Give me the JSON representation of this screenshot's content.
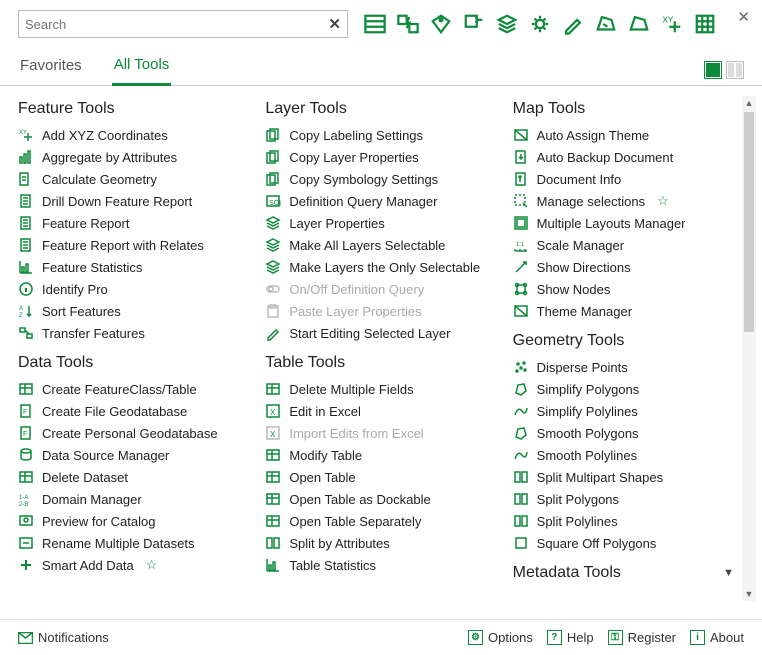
{
  "search": {
    "placeholder": "Search"
  },
  "tabs": {
    "favorites": "Favorites",
    "all_tools": "All Tools"
  },
  "toolbar_icons": [
    "panel",
    "bolt",
    "tag",
    "ins",
    "layers",
    "gear",
    "edit",
    "poly1",
    "poly2",
    "xy",
    "grid"
  ],
  "columns": [
    {
      "categories": [
        {
          "title": "Feature Tools",
          "tools": [
            {
              "label": "Add XYZ Coordinates",
              "icon": "xy"
            },
            {
              "label": "Aggregate by Attributes",
              "icon": "bars"
            },
            {
              "label": "Calculate Geometry",
              "icon": "calc"
            },
            {
              "label": "Drill Down Feature Report",
              "icon": "report"
            },
            {
              "label": "Feature Report",
              "icon": "report"
            },
            {
              "label": "Feature Report with Relates",
              "icon": "report"
            },
            {
              "label": "Feature Statistics",
              "icon": "stats"
            },
            {
              "label": "Identify Pro",
              "icon": "info"
            },
            {
              "label": "Sort Features",
              "icon": "sort"
            },
            {
              "label": "Transfer Features",
              "icon": "transfer"
            }
          ]
        },
        {
          "title": "Data Tools",
          "tools": [
            {
              "label": "Create FeatureClass/Table",
              "icon": "table"
            },
            {
              "label": "Create File Geodatabase",
              "icon": "file"
            },
            {
              "label": "Create Personal Geodatabase",
              "icon": "file"
            },
            {
              "label": "Data Source Manager",
              "icon": "db"
            },
            {
              "label": "Delete Dataset",
              "icon": "table"
            },
            {
              "label": "Domain Manager",
              "icon": "domain"
            },
            {
              "label": "Preview for Catalog",
              "icon": "preview"
            },
            {
              "label": "Rename Multiple Datasets",
              "icon": "rename"
            },
            {
              "label": "Smart Add Data",
              "icon": "add",
              "starred": true
            }
          ]
        }
      ]
    },
    {
      "categories": [
        {
          "title": "Layer Tools",
          "tools": [
            {
              "label": "Copy Labeling Settings",
              "icon": "copy"
            },
            {
              "label": "Copy Layer Properties",
              "icon": "copy"
            },
            {
              "label": "Copy Symbology Settings",
              "icon": "copy"
            },
            {
              "label": "Definition Query Manager",
              "icon": "query"
            },
            {
              "label": "Layer Properties",
              "icon": "layers"
            },
            {
              "label": "Make All Layers Selectable",
              "icon": "layers"
            },
            {
              "label": "Make Layers the Only Selectable",
              "icon": "layers"
            },
            {
              "label": "On/Off Definition Query",
              "icon": "toggle",
              "disabled": true
            },
            {
              "label": "Paste Layer Properties",
              "icon": "paste",
              "disabled": true
            },
            {
              "label": "Start Editing Selected Layer",
              "icon": "edit"
            }
          ]
        },
        {
          "title": "Table Tools",
          "tools": [
            {
              "label": "Delete Multiple Fields",
              "icon": "table"
            },
            {
              "label": "Edit in Excel",
              "icon": "excel"
            },
            {
              "label": "Import Edits from Excel",
              "icon": "excel",
              "disabled": true
            },
            {
              "label": "Modify Table",
              "icon": "table"
            },
            {
              "label": "Open Table",
              "icon": "table"
            },
            {
              "label": "Open Table as Dockable",
              "icon": "table"
            },
            {
              "label": "Open Table Separately",
              "icon": "table"
            },
            {
              "label": "Split by Attributes",
              "icon": "split"
            },
            {
              "label": "Table Statistics",
              "icon": "stats"
            }
          ]
        }
      ]
    },
    {
      "categories": [
        {
          "title": "Map Tools",
          "tools": [
            {
              "label": "Auto Assign Theme",
              "icon": "theme"
            },
            {
              "label": "Auto Backup Document",
              "icon": "backup"
            },
            {
              "label": "Document Info",
              "icon": "info2"
            },
            {
              "label": "Manage selections",
              "icon": "select",
              "starred": true
            },
            {
              "label": "Multiple Layouts Manager",
              "icon": "layout"
            },
            {
              "label": "Scale Manager",
              "icon": "scale"
            },
            {
              "label": "Show Directions",
              "icon": "dir"
            },
            {
              "label": "Show Nodes",
              "icon": "nodes"
            },
            {
              "label": "Theme Manager",
              "icon": "theme"
            }
          ]
        },
        {
          "title": "Geometry Tools",
          "tools": [
            {
              "label": "Disperse Points",
              "icon": "points"
            },
            {
              "label": "Simplify Polygons",
              "icon": "poly"
            },
            {
              "label": "Simplify Polylines",
              "icon": "line"
            },
            {
              "label": "Smooth Polygons",
              "icon": "poly"
            },
            {
              "label": "Smooth Polylines",
              "icon": "line"
            },
            {
              "label": "Split Multipart Shapes",
              "icon": "split"
            },
            {
              "label": "Split Polygons",
              "icon": "split"
            },
            {
              "label": "Split Polylines",
              "icon": "split"
            },
            {
              "label": "Square Off Polygons",
              "icon": "square"
            }
          ]
        },
        {
          "title": "Metadata Tools",
          "collapsed": true,
          "tools": []
        }
      ]
    }
  ],
  "footer": {
    "notifications": "Notifications",
    "options": "Options",
    "help": "Help",
    "register": "Register",
    "about": "About"
  }
}
